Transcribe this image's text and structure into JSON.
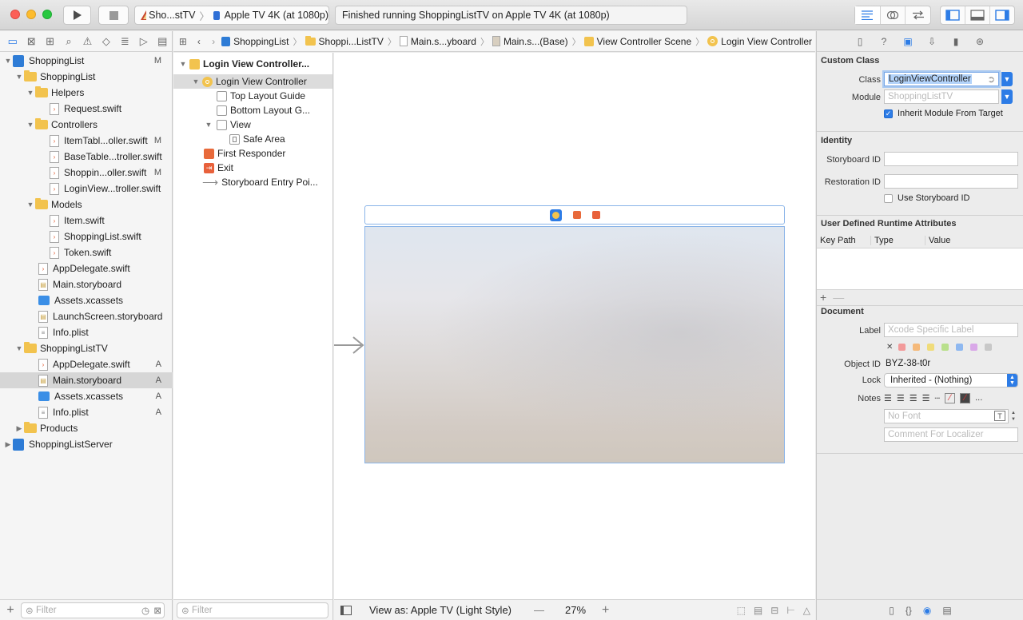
{
  "toolbar": {
    "scheme_target": "Sho...stTV",
    "device": "Apple TV 4K (at 1080p)",
    "status": "Finished running ShoppingListTV on Apple TV 4K (at 1080p)"
  },
  "navigator": {
    "filter_placeholder": "Filter",
    "items": [
      {
        "label": "ShoppingList",
        "badge": "M"
      },
      {
        "label": "ShoppingList",
        "badge": ""
      },
      {
        "label": "Helpers",
        "badge": ""
      },
      {
        "label": "Request.swift",
        "badge": ""
      },
      {
        "label": "Controllers",
        "badge": ""
      },
      {
        "label": "ItemTabl...oller.swift",
        "badge": "M"
      },
      {
        "label": "BaseTable...troller.swift",
        "badge": ""
      },
      {
        "label": "Shoppin...oller.swift",
        "badge": "M"
      },
      {
        "label": "LoginView...troller.swift",
        "badge": ""
      },
      {
        "label": "Models",
        "badge": ""
      },
      {
        "label": "Item.swift",
        "badge": ""
      },
      {
        "label": "ShoppingList.swift",
        "badge": ""
      },
      {
        "label": "Token.swift",
        "badge": ""
      },
      {
        "label": "AppDelegate.swift",
        "badge": ""
      },
      {
        "label": "Main.storyboard",
        "badge": ""
      },
      {
        "label": "Assets.xcassets",
        "badge": ""
      },
      {
        "label": "LaunchScreen.storyboard",
        "badge": ""
      },
      {
        "label": "Info.plist",
        "badge": ""
      },
      {
        "label": "ShoppingListTV",
        "badge": ""
      },
      {
        "label": "AppDelegate.swift",
        "badge": "A"
      },
      {
        "label": "Main.storyboard",
        "badge": "A"
      },
      {
        "label": "Assets.xcassets",
        "badge": "A"
      },
      {
        "label": "Info.plist",
        "badge": "A"
      },
      {
        "label": "Products",
        "badge": ""
      },
      {
        "label": "ShoppingListServer",
        "badge": ""
      }
    ]
  },
  "jumpbar": {
    "crumbs": [
      "ShoppingList",
      "Shoppi...ListTV",
      "Main.s...yboard",
      "Main.s...(Base)",
      "View Controller Scene",
      "Login View Controller"
    ]
  },
  "outline": {
    "filter_placeholder": "Filter",
    "items": [
      {
        "label": "Login View Controller..."
      },
      {
        "label": "Login View Controller"
      },
      {
        "label": "Top Layout Guide"
      },
      {
        "label": "Bottom Layout G..."
      },
      {
        "label": "View"
      },
      {
        "label": "Safe Area"
      },
      {
        "label": "First Responder"
      },
      {
        "label": "Exit"
      },
      {
        "label": "Storyboard Entry Poi..."
      }
    ]
  },
  "canvas_bottom": {
    "view_as": "View as: Apple TV (Light Style)",
    "zoom_out": "—",
    "zoom": "27%",
    "zoom_in": "+"
  },
  "inspector": {
    "custom_class": {
      "title": "Custom Class",
      "class_label": "Class",
      "class_value": "LoginViewController",
      "module_label": "Module",
      "module_placeholder": "ShoppingListTV",
      "inherit_label": "Inherit Module From Target"
    },
    "identity": {
      "title": "Identity",
      "storyboard_id_label": "Storyboard ID",
      "restoration_id_label": "Restoration ID",
      "use_storyboard_id_label": "Use Storyboard ID"
    },
    "runtime": {
      "title": "User Defined Runtime Attributes",
      "columns": [
        "Key Path",
        "Type",
        "Value"
      ],
      "add": "+",
      "remove": "—"
    },
    "document": {
      "title": "Document",
      "label_label": "Label",
      "label_placeholder": "Xcode Specific Label",
      "clear_mark": "✕",
      "object_id_label": "Object ID",
      "object_id": "BYZ-38-t0r",
      "lock_label": "Lock",
      "lock_value": "Inherited - (Nothing)",
      "notes_label": "Notes",
      "font_placeholder": "No Font",
      "comment_placeholder": "Comment For Localizer",
      "more": "..."
    }
  },
  "colors": {
    "accent": "#2d7ce6",
    "swatches": [
      "#f29a9a",
      "#f5b97a",
      "#f0dc7a",
      "#b9e08c",
      "#8fb8f0",
      "#d9a8e8",
      "#c8c8c8"
    ]
  }
}
